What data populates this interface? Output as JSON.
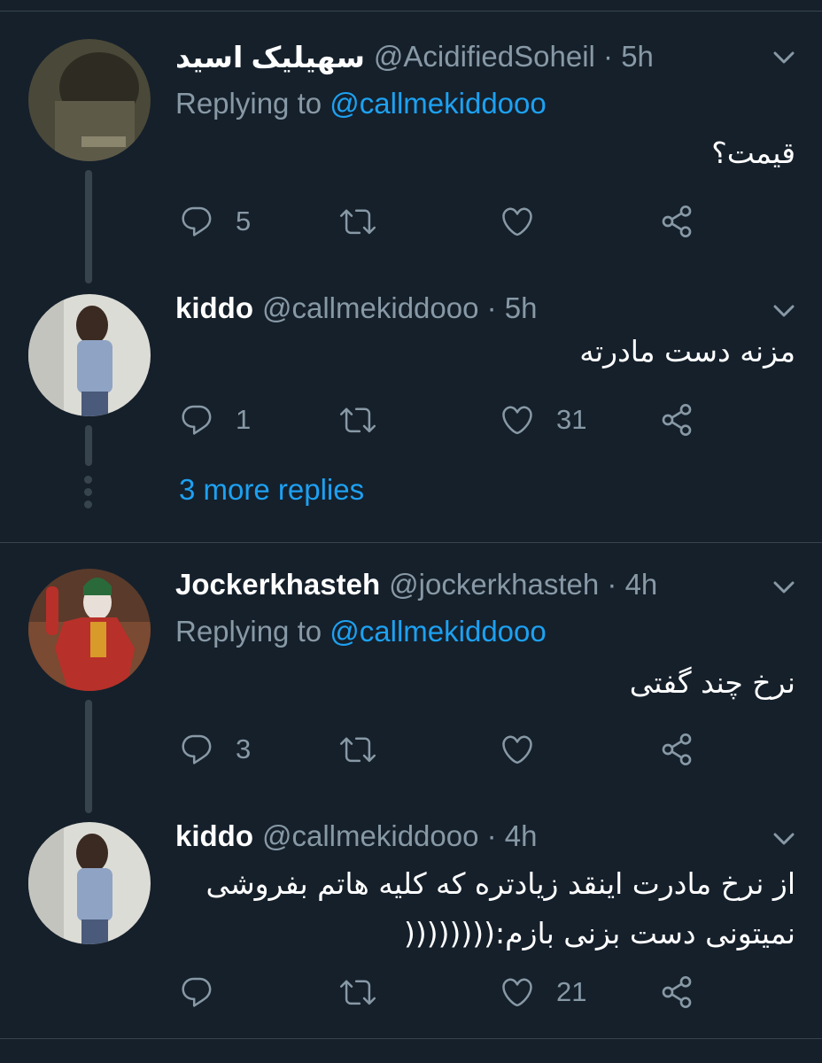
{
  "tweets": [
    {
      "name": "سهیلیک اسید",
      "handle": "@AcidifiedSoheil · 5h",
      "replying_prefix": "Replying to",
      "replying_to": "@callmekiddooo",
      "text": "قیمت؟",
      "reply_count": "5",
      "retweet_count": "",
      "like_count": ""
    },
    {
      "name": "kiddo",
      "handle": "@callmekiddooo · 5h",
      "text": "مزنه دست مادرته",
      "reply_count": "1",
      "retweet_count": "",
      "like_count": "31"
    },
    {
      "name": "Jockerkhasteh",
      "handle": "@jockerkhasteh · 4h",
      "replying_prefix": "Replying to",
      "replying_to": "@callmekiddooo",
      "text": "نرخ چند گفتی",
      "reply_count": "3",
      "retweet_count": "",
      "like_count": ""
    },
    {
      "name": "kiddo",
      "handle": "@callmekiddooo · 4h",
      "text": "از نرخ مادرت اینقد زیادتره که کلیه هاتم بفروشی نمیتونی دست بزنی بازم:((((((((",
      "reply_count": "",
      "retweet_count": "",
      "like_count": "21"
    }
  ],
  "more_replies": "3 more replies",
  "icons": {
    "reply": "reply-icon",
    "retweet": "retweet-icon",
    "like": "heart-icon",
    "share": "share-icon",
    "menu": "chevron-down-icon"
  },
  "colors": {
    "background": "#15202b",
    "secondary_text": "#8899a6",
    "link": "#1da1f2",
    "divider": "#38444d"
  }
}
